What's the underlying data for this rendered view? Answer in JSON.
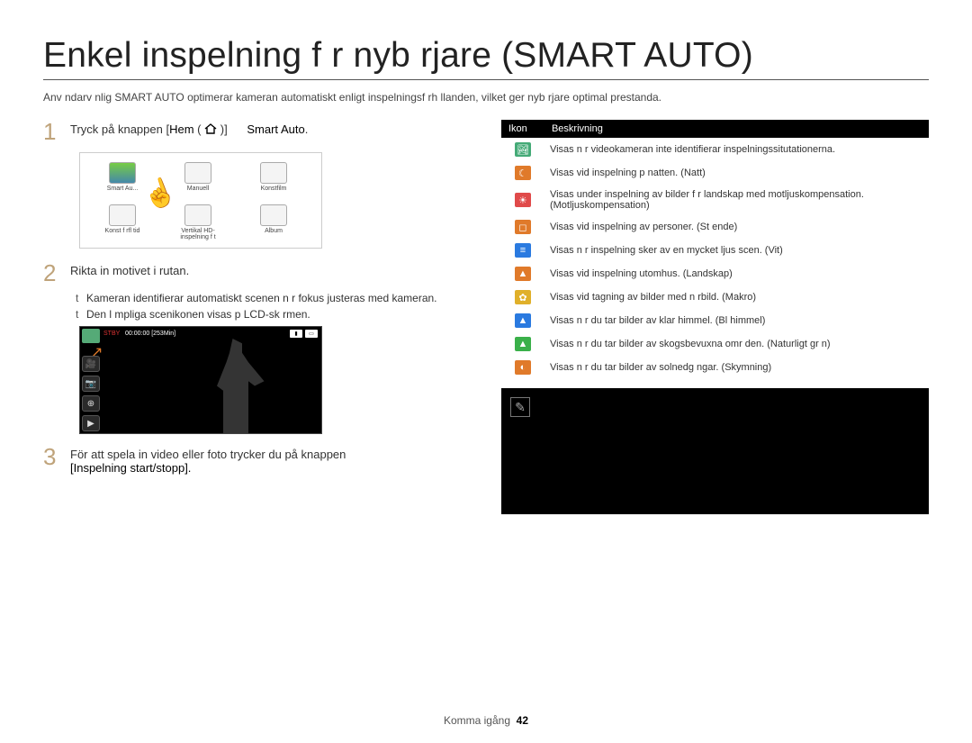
{
  "title": "Enkel inspelning f r nyb rjare (SMART AUTO)",
  "intro": "Anv ndarv nlig SMART AUTO optimerar kameran automatiskt enligt inspelningsf rh llanden, vilket ger nyb rjare optimal prestanda.",
  "steps": {
    "s1_pre": "Tryck på knappen [",
    "s1_home": "Hem",
    "s1_home_paren": "(",
    "s1_home_paren2": ")]",
    "s1_arrow": " ",
    "s1_smart": "Smart Auto",
    "s1_dot": ".",
    "s2": "Rikta in motivet i rutan.",
    "s2_b1": "Kameran identifierar automatiskt scenen n r fokus justeras med kameran.",
    "s2_b2": "Den l mpliga scenikonen visas p  LCD-sk rmen.",
    "s3_a": "För att spela in video eller foto trycker du på knappen",
    "s3_b": "[Inspelning start/stopp]."
  },
  "tiles": [
    "Smart Au...",
    "Manuell",
    "Konstfilm",
    "Konst f rfl tid",
    "Vertikal HD-inspelning f t",
    "Album"
  ],
  "lcd": {
    "stby": "STBY",
    "time": "00:00:00 [253Min]"
  },
  "table": {
    "h1": "Ikon",
    "h2": "Beskrivning",
    "rows": [
      {
        "color": "#4a7",
        "glyph": "🏞",
        "text": "Visas n r videokameran inte identifierar inspelningssitutationerna."
      },
      {
        "color": "#e07a2a",
        "glyph": "☾",
        "text": "Visas vid inspelning p  natten. (Natt)"
      },
      {
        "color": "#e04a4a",
        "glyph": "☀",
        "text": "Visas under inspelning av bilder f r landskap med motljuskompensation. (Motljuskompensation)"
      },
      {
        "color": "#e07a2a",
        "glyph": "◻",
        "text": "Visas vid inspelning av personer. (St ende)"
      },
      {
        "color": "#2a7ae0",
        "glyph": "≡",
        "text": "Visas n r inspelning sker av en mycket ljus scen. (Vit)"
      },
      {
        "color": "#e07a2a",
        "glyph": "▲",
        "text": "Visas vid inspelning utomhus. (Landskap)"
      },
      {
        "color": "#e0b02a",
        "glyph": "✿",
        "text": "Visas vid tagning av bilder med n rbild. (Makro)"
      },
      {
        "color": "#2a7ae0",
        "glyph": "▲",
        "text": "Visas n r du tar bilder av klar himmel. (Bl  himmel)"
      },
      {
        "color": "#3ab04a",
        "glyph": "▲",
        "text": "Visas n r du tar bilder av skogsbevuxna omr den. (Naturligt gr n)"
      },
      {
        "color": "#e07a2a",
        "glyph": "◐",
        "text": "Visas n r du tar bilder av solnedg ngar. (Skymning)"
      }
    ]
  },
  "footer": {
    "section": "Komma igång",
    "page": "42"
  }
}
